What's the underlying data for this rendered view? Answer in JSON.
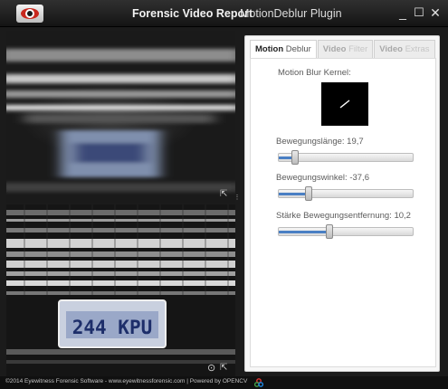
{
  "window": {
    "title_main": "Forensic Video Report",
    "title_sub": "MotionDeblur Plugin",
    "logo_icon": "eye-logo-icon",
    "buttons": {
      "minimize": "_",
      "maximize": "☐",
      "close": "✕"
    }
  },
  "video": {
    "top_plate_text": "Blurred",
    "bottom_plate_text": "244 KPU",
    "expand_icon": "⇱",
    "snapshot_icon": "⊙",
    "splitter_grip": "⋮"
  },
  "panel": {
    "tabs": [
      {
        "bold": "Motion",
        "sub": "Deblur",
        "active": true
      },
      {
        "bold": "Video",
        "sub": "Filter",
        "active": false
      },
      {
        "bold": "Video",
        "sub": "Extras",
        "active": false
      }
    ],
    "kernel_label": "Motion Blur Kernel:",
    "sliders": [
      {
        "label": "Bewegungslänge: 19,7",
        "fraction": 0.12
      },
      {
        "label": "Bewegungswinkel: -37,6",
        "fraction": 0.22
      },
      {
        "label": "Stärke Bewegungsentfernung: 10,2",
        "fraction": 0.37
      }
    ]
  },
  "statusbar": {
    "text": "©2014 Eyewitness Forensic Software - www.eyewitnessforensic.com  |  Powered by OPENCV"
  },
  "colors": {
    "accent": "#4a7fc4",
    "titlebar": "#1f1f1f",
    "logo_red": "#c8281e"
  }
}
